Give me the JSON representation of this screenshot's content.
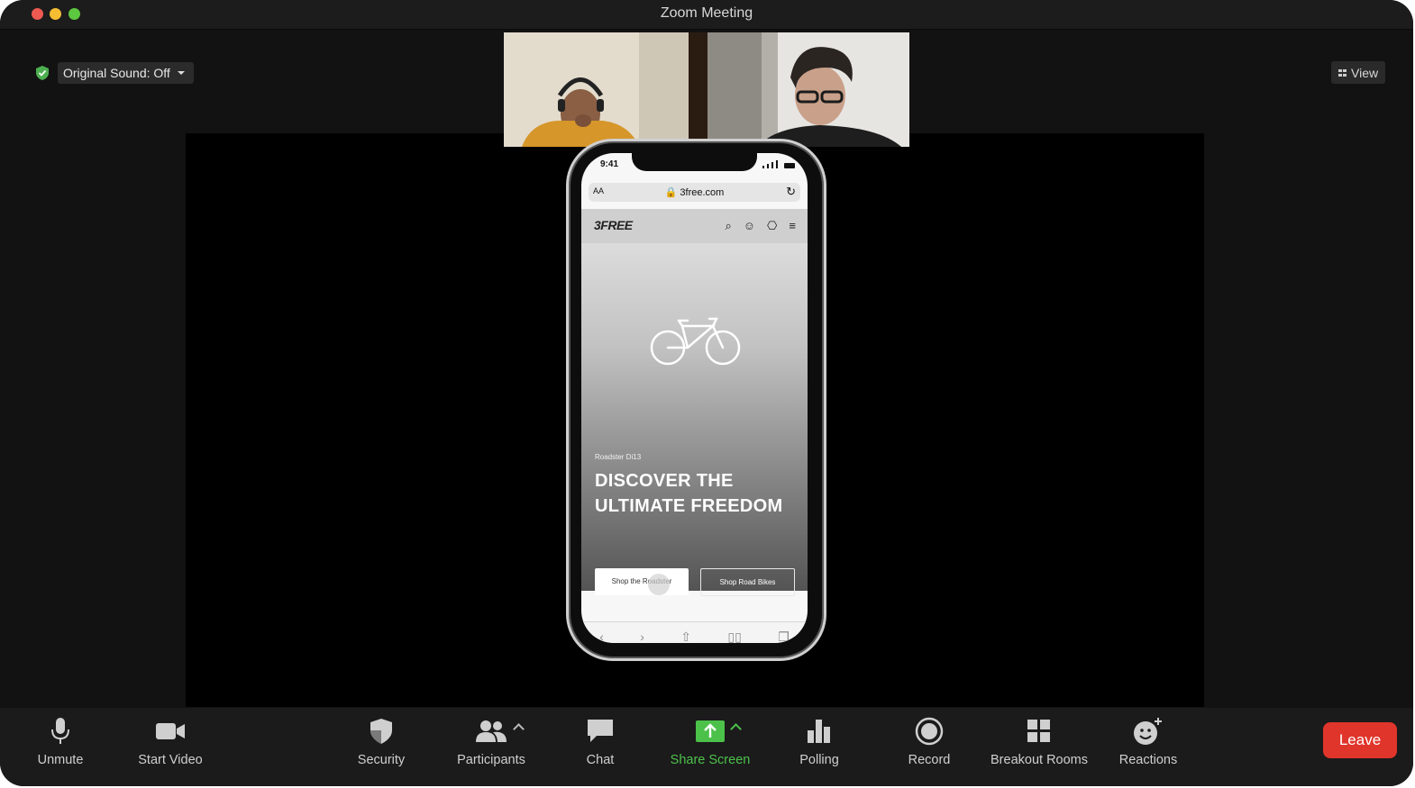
{
  "window": {
    "title": "Zoom Meeting"
  },
  "top_controls": {
    "original_sound_label": "Original Sound: Off",
    "view_label": "View"
  },
  "phone": {
    "time": "9:41",
    "text_size_label": "AA",
    "url": "3free.com",
    "logo": "3FREE",
    "subtitle": "Roadster Di13",
    "headline_line1": "DISCOVER THE",
    "headline_line2": "ULTIMATE FREEDOM",
    "button_primary": "Shop the Roadster",
    "button_secondary": "Shop Road Bikes"
  },
  "toolbar": {
    "unmute": "Unmute",
    "start_video": "Start Video",
    "security": "Security",
    "participants": "Participants",
    "chat": "Chat",
    "share_screen": "Share Screen",
    "polling": "Polling",
    "record": "Record",
    "breakout_rooms": "Breakout Rooms",
    "reactions": "Reactions",
    "leave": "Leave"
  },
  "colors": {
    "share_green": "#4cc14a",
    "leave_red": "#e0352b",
    "shield_green": "#4caf50"
  }
}
